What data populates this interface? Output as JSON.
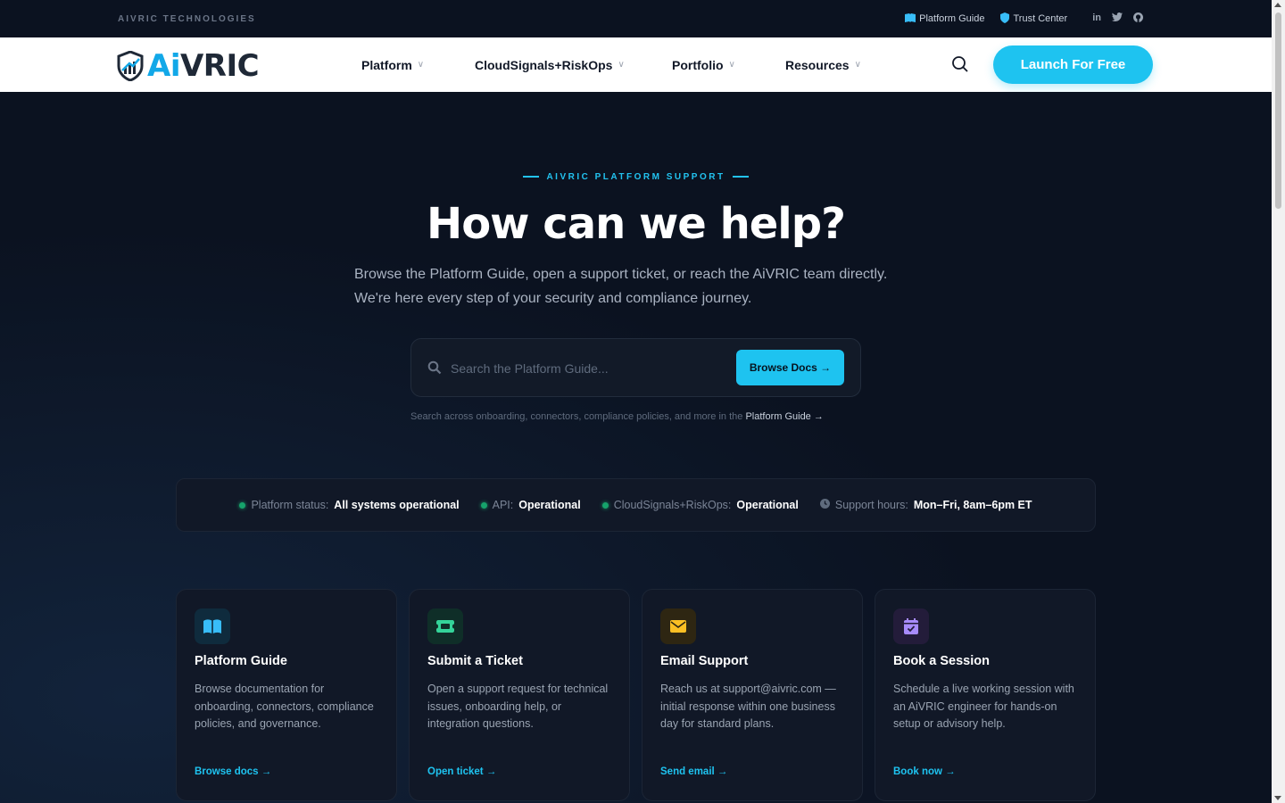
{
  "topbar": {
    "brand": "AIVRIC TECHNOLOGIES",
    "links": [
      {
        "label": "Platform Guide",
        "icon": "book-icon"
      },
      {
        "label": "Trust Center",
        "icon": "shield-icon"
      }
    ],
    "socials": [
      "in",
      "twitter",
      "github"
    ]
  },
  "header": {
    "logo_ai": "Ai",
    "logo_vric": "VRIC",
    "nav": [
      {
        "label": "Platform"
      },
      {
        "label": "CloudSignals+RiskOps"
      },
      {
        "label": "Portfolio"
      },
      {
        "label": "Resources"
      }
    ],
    "chevron": "∨",
    "cta": "Launch For Free"
  },
  "hero": {
    "eyebrow": "AIVRIC PLATFORM SUPPORT",
    "title": "How can we help?",
    "subtitle": "Browse the Platform Guide, open a support ticket, or reach the AiVRIC team directly. We're here every step of your security and compliance journey.",
    "search_placeholder": "Search the Platform Guide...",
    "search_button": "Browse Docs →",
    "hint_text": "Search across onboarding, connectors, compliance policies, and more in the ",
    "hint_link": "Platform Guide →"
  },
  "status": [
    {
      "label": "Platform status:",
      "value": "All systems operational",
      "kind": "dot"
    },
    {
      "label": "API:",
      "value": "Operational",
      "kind": "dot"
    },
    {
      "label": "CloudSignals+RiskOps:",
      "value": "Operational",
      "kind": "dot"
    },
    {
      "label": "Support hours:",
      "value": "Mon–Fri, 8am–6pm ET",
      "kind": "clock"
    }
  ],
  "cards": [
    {
      "title": "Platform Guide",
      "body": "Browse documentation for onboarding, connectors, compliance policies, and governance.",
      "link": "Browse docs →",
      "icon": "book-icon",
      "icon_bg": "#0f2b3d",
      "icon_color": "#38bdf8"
    },
    {
      "title": "Submit a Ticket",
      "body": "Open a support request for technical issues, onboarding help, or integration questions.",
      "link": "Open ticket →",
      "icon": "ticket-icon",
      "icon_bg": "#0f2e28",
      "icon_color": "#34d399"
    },
    {
      "title": "Email Support",
      "body": "Reach us at support@aivric.com — initial response within one business day for standard plans.",
      "link": "Send email →",
      "icon": "mail-icon",
      "icon_bg": "#2e2612",
      "icon_color": "#fbbf24"
    },
    {
      "title": "Book a Session",
      "body": "Schedule a live working session with an AiVRIC engineer for hands-on setup or advisory help.",
      "link": "Book now →",
      "icon": "calendar-icon",
      "icon_bg": "#231c3a",
      "icon_color": "#a78bfa"
    }
  ]
}
